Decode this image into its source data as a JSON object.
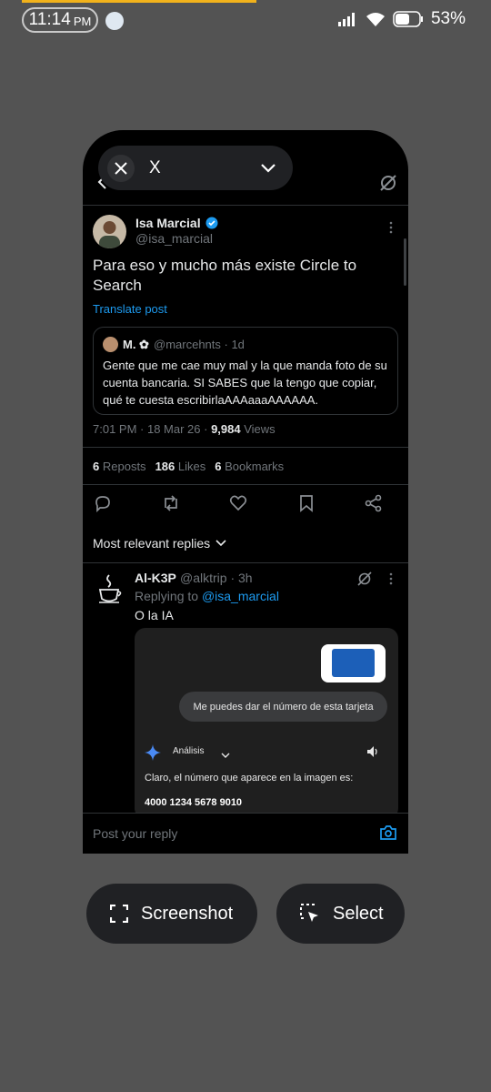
{
  "status_bar": {
    "time": "11:14",
    "ampm": "PM",
    "battery": "53%"
  },
  "app_switcher": {
    "app_name": "X"
  },
  "post": {
    "author_name": "Isa Marcial",
    "author_handle": "@isa_marcial",
    "text": "Para eso y mucho más existe Circle to Search",
    "translate": "Translate post",
    "quote": {
      "name": "M. ✿",
      "handle_time": "@marcehnts · 1d",
      "text": "Gente que me cae muy mal y la que manda foto de su cuenta bancaria. SI SABES que la tengo que copiar, qué te cuesta escribirlaAAAaaaAAAAAA."
    },
    "time_date": "7:01 PM · 18 Mar 26 · ",
    "views_count": "9,984",
    "views_label": " Views",
    "reposts_count": "6",
    "reposts_label": "Reposts",
    "likes_count": "186",
    "likes_label": "Likes",
    "bookmarks_count": "6",
    "bookmarks_label": "Bookmarks"
  },
  "replies_filter": "Most relevant replies",
  "reply": {
    "name": "Al-K3P",
    "handle_time": "@alktrip · 3h",
    "replying_prefix": "Replying to ",
    "replying_handle": "@isa_marcial",
    "text": "O la IA",
    "embed": {
      "user_message": "Me puedes dar el número de esta tarjeta",
      "assistant_label": "Análisis",
      "answer": "Claro, el número que aparece en la imagen es:",
      "card_number": "4000 1234 5678 9010"
    }
  },
  "composer": {
    "placeholder": "Post your reply"
  },
  "bottom_buttons": {
    "screenshot": "Screenshot",
    "select": "Select"
  },
  "colors": {
    "accent": "#1d9bf0",
    "background": "#535353",
    "card": "#000000"
  }
}
